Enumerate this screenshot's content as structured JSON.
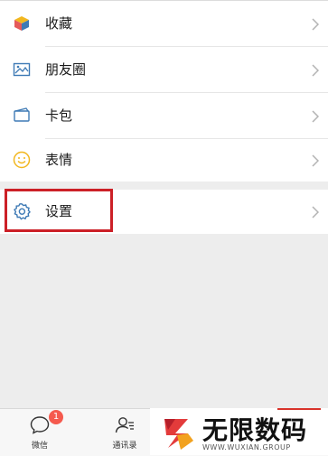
{
  "menu": {
    "items": [
      {
        "label": "收藏",
        "icon": "favorites-cube-icon"
      },
      {
        "label": "朋友圈",
        "icon": "moments-image-icon"
      },
      {
        "label": "卡包",
        "icon": "card-package-icon"
      },
      {
        "label": "表情",
        "icon": "sticker-smile-icon"
      }
    ],
    "settings": {
      "label": "设置",
      "icon": "gear-icon"
    }
  },
  "tabbar": {
    "chats_label": "微信",
    "chats_badge": "1",
    "contacts_label": "通讯录"
  },
  "watermark": {
    "title": "无限数码",
    "subtitle": "WWW.WUXIAN.GROUP"
  },
  "colors": {
    "highlight": "#cc2027",
    "badge": "#f55a4e",
    "icon_blue": "#3e7ab5",
    "icon_yellow": "#f2b71f",
    "background": "#ededed"
  }
}
